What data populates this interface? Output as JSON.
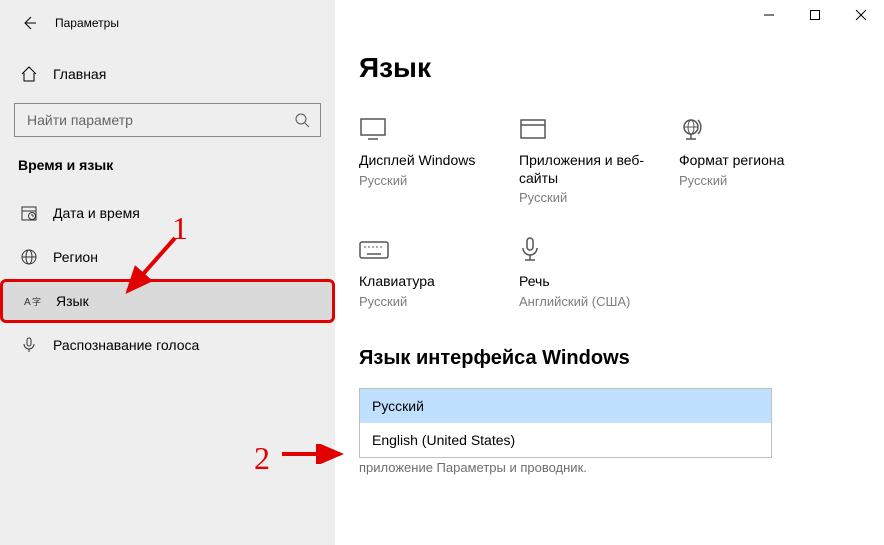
{
  "window": {
    "title": "Параметры"
  },
  "sidebar": {
    "home_label": "Главная",
    "search_placeholder": "Найти параметр",
    "group_header": "Время и язык",
    "items": [
      {
        "label": "Дата и время"
      },
      {
        "label": "Регион"
      },
      {
        "label": "Язык"
      },
      {
        "label": "Распознавание голоса"
      }
    ]
  },
  "page": {
    "title": "Язык",
    "tiles": [
      {
        "title": "Дисплей Windows",
        "sub": "Русский"
      },
      {
        "title": "Приложения и веб-сайты",
        "sub": "Русский"
      },
      {
        "title": "Формат региона",
        "sub": "Русский"
      },
      {
        "title": "Клавиатура",
        "sub": "Русский"
      },
      {
        "title": "Речь",
        "sub": "Английский (США)"
      }
    ],
    "section_title": "Язык интерфейса Windows",
    "dropdown_options": [
      {
        "label": "Русский"
      },
      {
        "label": "English (United States)"
      }
    ],
    "below_text": "приложение  Параметры  и проводник."
  },
  "annotations": {
    "num1": "1",
    "num2": "2"
  }
}
